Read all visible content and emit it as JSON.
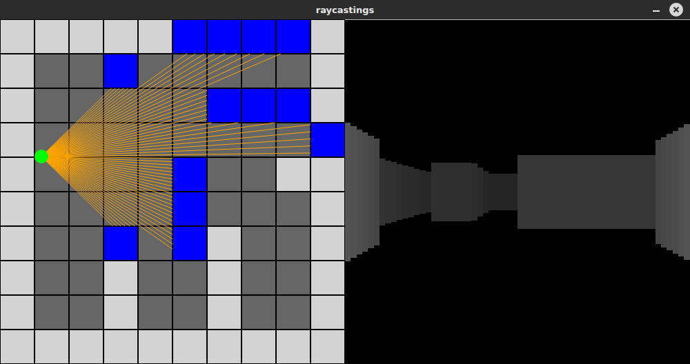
{
  "window": {
    "title": "raycastings"
  },
  "map": {
    "rows": [
      "#####BBBB#",
      "#..B.....#",
      "#.....BBB#",
      "#........B",
      "#....B..##",
      "#....B...#",
      "#..B.B#..#",
      "#..#..#..#",
      "#..#..#..#",
      "##########"
    ]
  },
  "player": {
    "x": 1.2,
    "y": 3.98,
    "angle": 0,
    "fov": 90,
    "rays": 60
  }
}
